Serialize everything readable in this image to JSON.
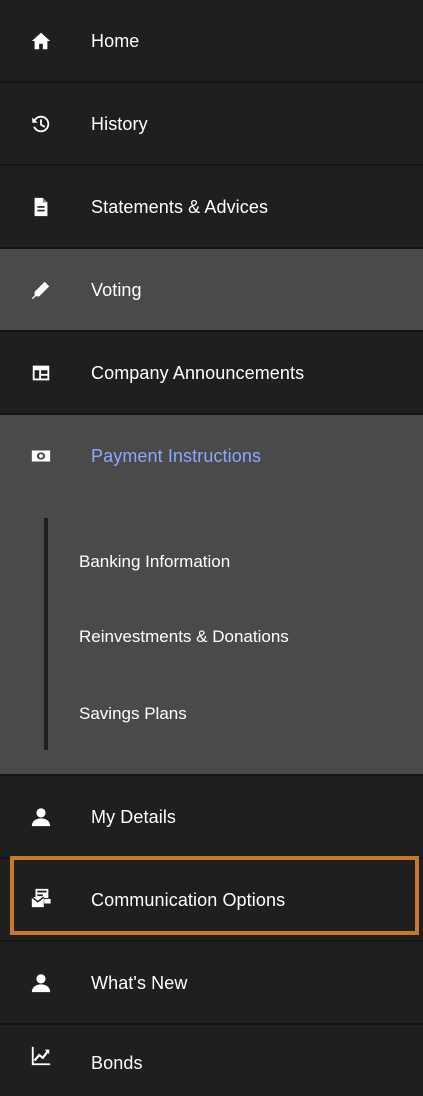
{
  "nav": {
    "items": [
      {
        "label": "Home",
        "icon": "home-icon"
      },
      {
        "label": "History",
        "icon": "history-icon"
      },
      {
        "label": "Statements & Advices",
        "icon": "document-icon"
      },
      {
        "label": "Voting",
        "icon": "pen-icon"
      },
      {
        "label": "Company Announcements",
        "icon": "announcements-icon"
      },
      {
        "label": "Payment Instructions",
        "icon": "money-icon"
      },
      {
        "label": "My Details",
        "icon": "person-icon"
      },
      {
        "label": "Communication Options",
        "icon": "communication-icon"
      },
      {
        "label": "What's New",
        "icon": "person-icon"
      },
      {
        "label": "Bonds",
        "icon": "chart-icon"
      }
    ],
    "submenu": [
      {
        "label": "Banking Information"
      },
      {
        "label": "Reinvestments & Donations"
      },
      {
        "label": "Savings Plans"
      }
    ]
  },
  "colors": {
    "dark_bg": "#1f1f1f",
    "gray_bg": "#4a4a4a",
    "active_text": "#8aa8ff",
    "highlight_border": "#c9782a"
  }
}
